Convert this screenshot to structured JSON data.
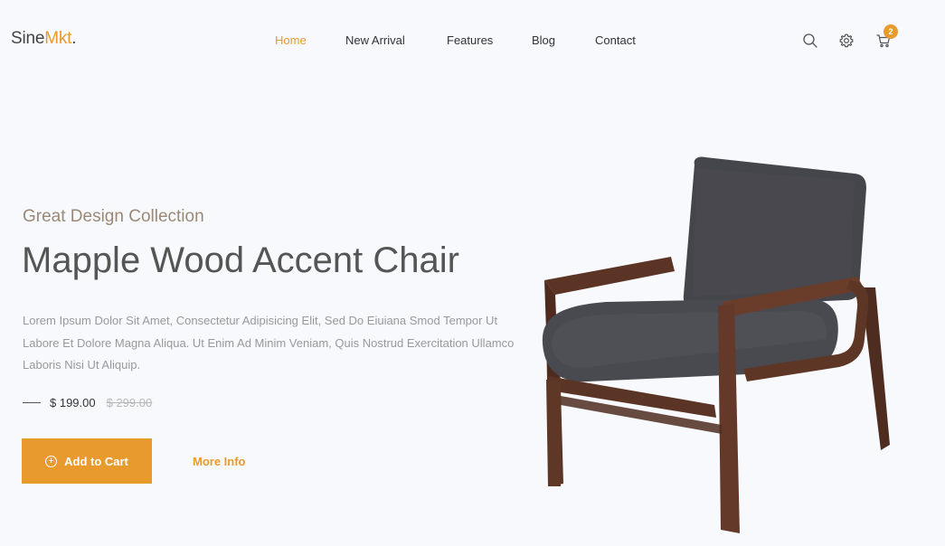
{
  "brand": {
    "name_main": "Sine",
    "name_accent": "Mkt",
    "name_dot": "."
  },
  "nav": {
    "items": [
      {
        "label": "Home",
        "active": true
      },
      {
        "label": "New Arrival",
        "active": false
      },
      {
        "label": "Features",
        "active": false
      },
      {
        "label": "Blog",
        "active": false
      },
      {
        "label": "Contact",
        "active": false
      }
    ]
  },
  "toolbar": {
    "icons": [
      "search-icon",
      "gear-icon",
      "cart-icon"
    ],
    "cart_count": "2"
  },
  "hero": {
    "kicker": "Great Design Collection",
    "title": "Mapple Wood Accent Chair",
    "description": "Lorem Ipsum Dolor Sit Amet, Consectetur Adipisicing Elit, Sed Do Eiuiana Smod Tempor Ut Labore Et Dolore Magna Aliqua. Ut Enim Ad Minim Veniam, Quis Nostrud Exercitation Ullamco Laboris Nisi Ut Aliquip.",
    "price": "$ 199.00",
    "old_price": "$ 299.00",
    "add_to_cart_label": "Add to Cart",
    "more_info_label": "More Info"
  },
  "colors": {
    "accent": "#e89a2c",
    "background": "#f8f9fc",
    "upholstery": "#45464c",
    "wood": "#5a3424"
  }
}
